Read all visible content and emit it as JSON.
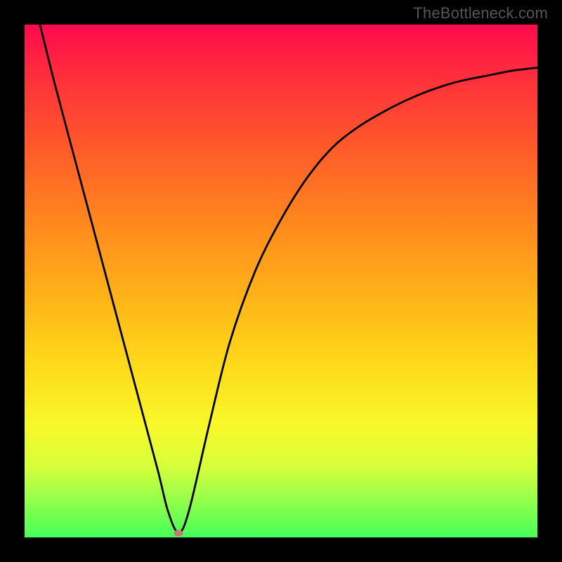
{
  "watermark": "TheBottleneck.com",
  "chart_data": {
    "type": "line",
    "title": "",
    "xlabel": "",
    "ylabel": "",
    "xlim": [
      0,
      100
    ],
    "ylim": [
      0,
      100
    ],
    "grid": false,
    "legend": false,
    "series": [
      {
        "name": "bottleneck-curve",
        "x": [
          3,
          6,
          10,
          14,
          18,
          22,
          26,
          28,
          30,
          32,
          36,
          40,
          45,
          50,
          55,
          60,
          65,
          70,
          75,
          80,
          85,
          90,
          95,
          100
        ],
        "values": [
          100,
          88,
          73,
          58,
          43,
          28,
          13,
          5,
          1,
          5,
          22,
          38,
          52,
          62,
          70,
          76,
          80,
          83,
          85.5,
          87.5,
          89,
          90,
          91,
          91.6
        ]
      }
    ],
    "annotations": [
      {
        "name": "minimum-marker",
        "x": 30,
        "y": 0.8,
        "color": "#c47a6e"
      }
    ],
    "background_gradient": {
      "top": "#ff0a4d",
      "bottom": "#46ff58"
    }
  }
}
